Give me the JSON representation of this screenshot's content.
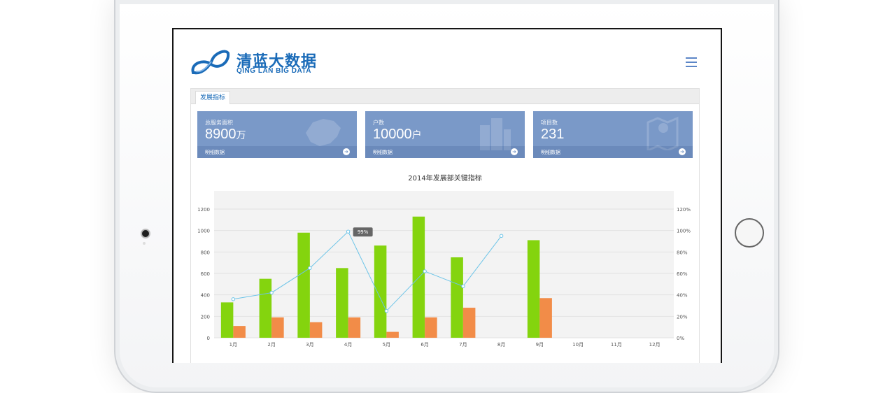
{
  "brand": {
    "name_cn": "清蓝大数据",
    "name_en": "QING LAN BIG DATA"
  },
  "tab": {
    "label": "发展指标"
  },
  "cards": [
    {
      "label": "总服务面积",
      "value": "8900",
      "unit": "万",
      "link": "明细数据",
      "icon": "china-map-icon"
    },
    {
      "label": "户数",
      "value": "10000",
      "unit": "户",
      "link": "明细数据",
      "icon": "buildings-icon"
    },
    {
      "label": "项目数",
      "value": "231",
      "unit": "",
      "link": "明细数据",
      "icon": "map-pin-icon"
    }
  ],
  "colors": {
    "bar_green": "#84d40e",
    "bar_orange": "#f28c48",
    "line": "#6cc4e8",
    "card": "#7a99c8",
    "brand": "#1a6bb8"
  },
  "chart_data": {
    "type": "bar",
    "title": "2014年发展部关键指标",
    "categories": [
      "1月",
      "2月",
      "3月",
      "4月",
      "5月",
      "6月",
      "7月",
      "8月",
      "9月",
      "10月",
      "11月",
      "12月"
    ],
    "series": [
      {
        "type": "bar",
        "axis": "left",
        "values": [
          330,
          550,
          980,
          650,
          860,
          1130,
          750,
          910,
          null,
          null,
          null,
          null
        ]
      },
      {
        "type": "bar",
        "axis": "left",
        "values": [
          110,
          190,
          145,
          190,
          55,
          190,
          280,
          370,
          null,
          null,
          null,
          null
        ]
      },
      {
        "type": "line",
        "axis": "right",
        "values": [
          36,
          42,
          65,
          99,
          25,
          62,
          48,
          95,
          null,
          null,
          null,
          null
        ]
      }
    ],
    "bar_series_x_index": [
      0,
      1,
      2,
      3,
      4,
      5,
      6,
      8
    ],
    "line_x_index": [
      0,
      1,
      2,
      3,
      4,
      5,
      6,
      7
    ],
    "y_left": {
      "min": 0,
      "max": 1200,
      "ticks": [
        "0",
        "200",
        "400",
        "600",
        "800",
        "1000",
        "1200"
      ]
    },
    "y_right": {
      "min": 0,
      "max": 120,
      "ticks": [
        "0%",
        "20%",
        "40%",
        "60%",
        "80%",
        "100%",
        "120%"
      ]
    },
    "tooltip": {
      "label": "99%"
    },
    "grid": true
  }
}
